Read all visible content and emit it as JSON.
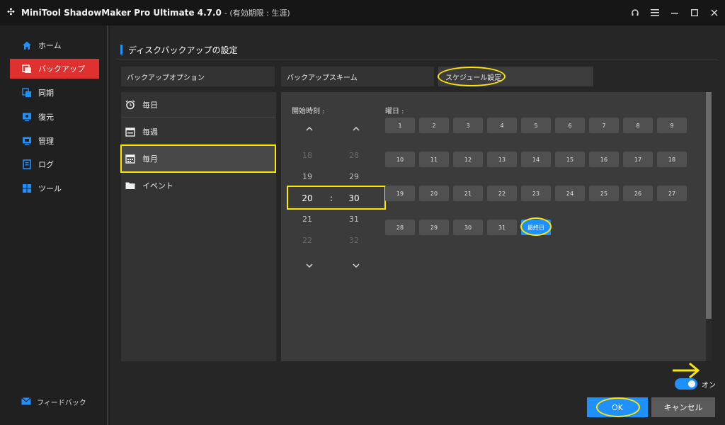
{
  "app": {
    "title": "MiniTool ShadowMaker Pro Ultimate 4.7.0",
    "subtitle": "- (有効期限 : 生涯)"
  },
  "sidebar": {
    "items": [
      {
        "label": "ホーム",
        "icon": "home-icon"
      },
      {
        "label": "バックアップ",
        "icon": "backup-icon"
      },
      {
        "label": "同期",
        "icon": "sync-icon"
      },
      {
        "label": "復元",
        "icon": "restore-icon"
      },
      {
        "label": "管理",
        "icon": "manage-icon"
      },
      {
        "label": "ログ",
        "icon": "log-icon"
      },
      {
        "label": "ツール",
        "icon": "tools-icon"
      }
    ],
    "feedback": "フィードバック"
  },
  "page": {
    "title": "ディスクバックアップの設定"
  },
  "tabs": [
    {
      "label": "バックアップオプション"
    },
    {
      "label": "バックアップスキーム"
    },
    {
      "label": "スケジュール設定"
    }
  ],
  "schedule_types": [
    {
      "label": "毎日",
      "icon": "alarm-clock-icon"
    },
    {
      "label": "毎週",
      "icon": "calendar-week-icon"
    },
    {
      "label": "毎月",
      "icon": "calendar-month-icon"
    },
    {
      "label": "イベント",
      "icon": "folder-icon"
    }
  ],
  "time": {
    "label": "開始時刻 :",
    "hours": [
      "18",
      "19",
      "20",
      "21",
      "22"
    ],
    "minutes": [
      "28",
      "29",
      "30",
      "31",
      "32"
    ],
    "separator": ":"
  },
  "days": {
    "label": "曜日 :",
    "items": [
      "1",
      "2",
      "3",
      "4",
      "5",
      "6",
      "7",
      "8",
      "9",
      "10",
      "11",
      "12",
      "13",
      "14",
      "15",
      "16",
      "17",
      "18",
      "19",
      "20",
      "21",
      "22",
      "23",
      "24",
      "25",
      "26",
      "27",
      "28",
      "29",
      "30",
      "31",
      "最終日"
    ],
    "selected": "最終日"
  },
  "toggle": {
    "label": "オン",
    "state": "on"
  },
  "buttons": {
    "ok": "OK",
    "cancel": "キャンセル"
  },
  "colors": {
    "accent": "#1e90ff",
    "active_nav": "#e03131",
    "highlight": "#ffe600"
  }
}
